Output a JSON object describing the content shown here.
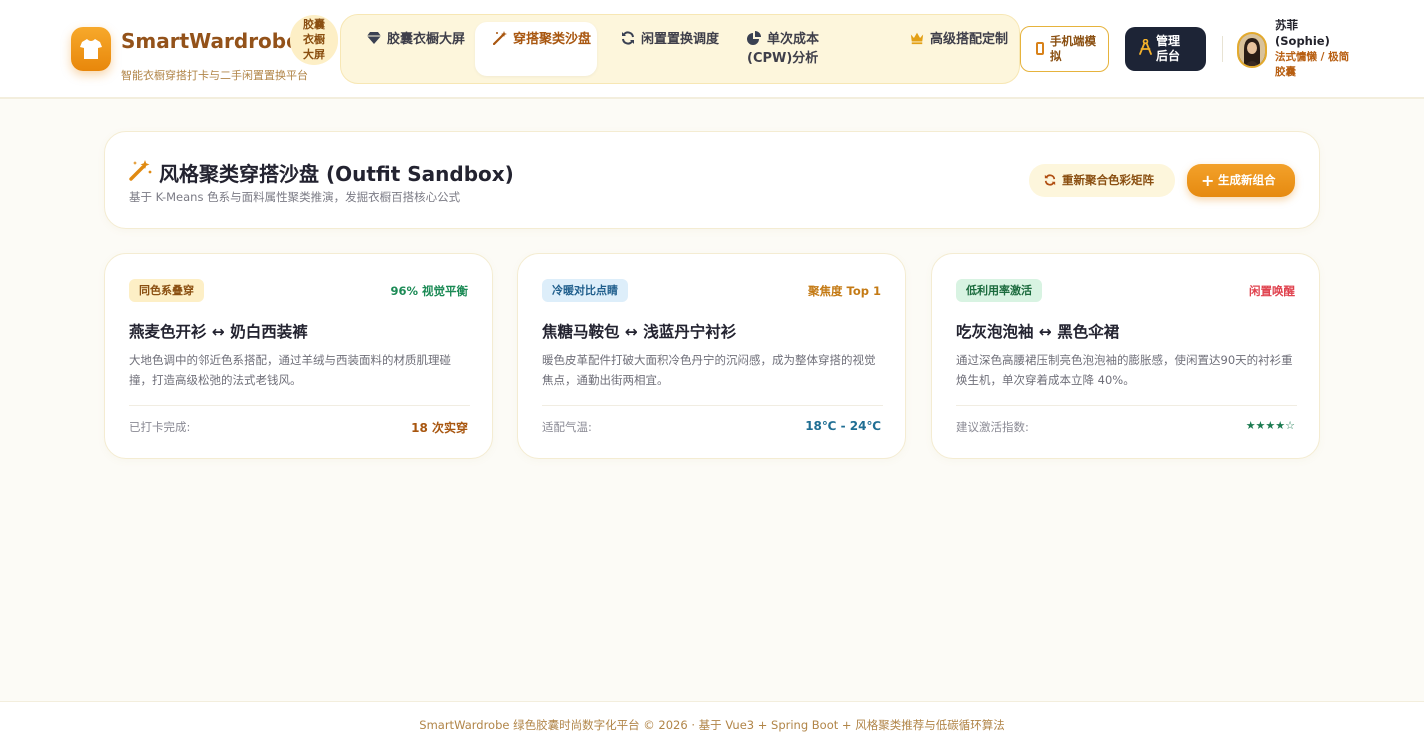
{
  "brand": {
    "name": "SmartWardrobe",
    "subtitle": "智能衣橱穿搭打卡与二手闲置置换平台",
    "badge": "胶囊衣橱大屏"
  },
  "nav": {
    "items": [
      {
        "label": "胶囊衣橱大屏",
        "icon": "gem-icon",
        "active": false
      },
      {
        "label": "穿搭聚类沙盘",
        "icon": "magic-wand-icon",
        "active": true
      },
      {
        "label": "闲置置换调度",
        "icon": "refresh-icon",
        "active": false
      },
      {
        "label": "单次成本 (CPW)分析",
        "icon": "pie-chart-icon",
        "active": false
      },
      {
        "label": "高级搭配定制",
        "icon": "crown-icon",
        "active": false
      }
    ]
  },
  "actions": {
    "mobile_label": "手机端模拟",
    "admin_label": "管理后台"
  },
  "user": {
    "name": "苏菲 (Sophie)",
    "role": "法式慵懒 / 极简胶囊"
  },
  "sandbox": {
    "title": "风格聚类穿搭沙盘 (Outfit Sandbox)",
    "subtitle": "基于 K-Means 色系与面料属性聚类推演，发掘衣橱百搭核心公式",
    "recluster_label": "重新聚合色彩矩阵",
    "generate_label": "生成新组合"
  },
  "cards": [
    {
      "tag": "同色系叠穿",
      "metric": "96% 视觉平衡",
      "title": "燕麦色开衫 ↔ 奶白西装裤",
      "desc": "大地色调中的邻近色系搭配，通过羊绒与西装面料的材质肌理碰撞，打造高级松弛的法式老钱风。",
      "foot_label": "已打卡完成:",
      "foot_value": "18 次实穿"
    },
    {
      "tag": "冷暖对比点睛",
      "metric": "聚焦度 Top 1",
      "title": "焦糖马鞍包 ↔ 浅蓝丹宁衬衫",
      "desc": "暖色皮革配件打破大面积冷色丹宁的沉闷感，成为整体穿搭的视觉焦点，通勤出街两相宜。",
      "foot_label": "适配气温:",
      "foot_value": "18℃ - 24℃"
    },
    {
      "tag": "低利用率激活",
      "metric": "闲置唤醒",
      "title": "吃灰泡泡袖 ↔ 黑色伞裙",
      "desc": "通过深色高腰裙压制亮色泡泡袖的膨胀感，使闲置达90天的衬衫重焕生机，单次穿着成本立降 40%。",
      "foot_label": "建议激活指数:",
      "foot_value": "★★★★☆"
    }
  ],
  "footer": {
    "text": "SmartWardrobe 绿色胶囊时尚数字化平台 © 2026 · 基于 Vue3 + Spring Boot + 风格聚类推荐与低碳循环算法"
  },
  "colors": {
    "brand": "#93521a",
    "accent": "#e8870b",
    "tag1_bg": "#fdefc6",
    "tag1_fg": "#8a4f11",
    "metric1": "#1b8a55",
    "foot1": "#a8560f",
    "tag2_bg": "#ddeefa",
    "tag2_fg": "#1f5e8c",
    "metric2": "#c47a14",
    "foot2": "#1f6e93",
    "tag3_bg": "#d8f3e2",
    "tag3_fg": "#1c6b3e",
    "metric3": "#e0434f",
    "foot3": "#1b7a50"
  }
}
